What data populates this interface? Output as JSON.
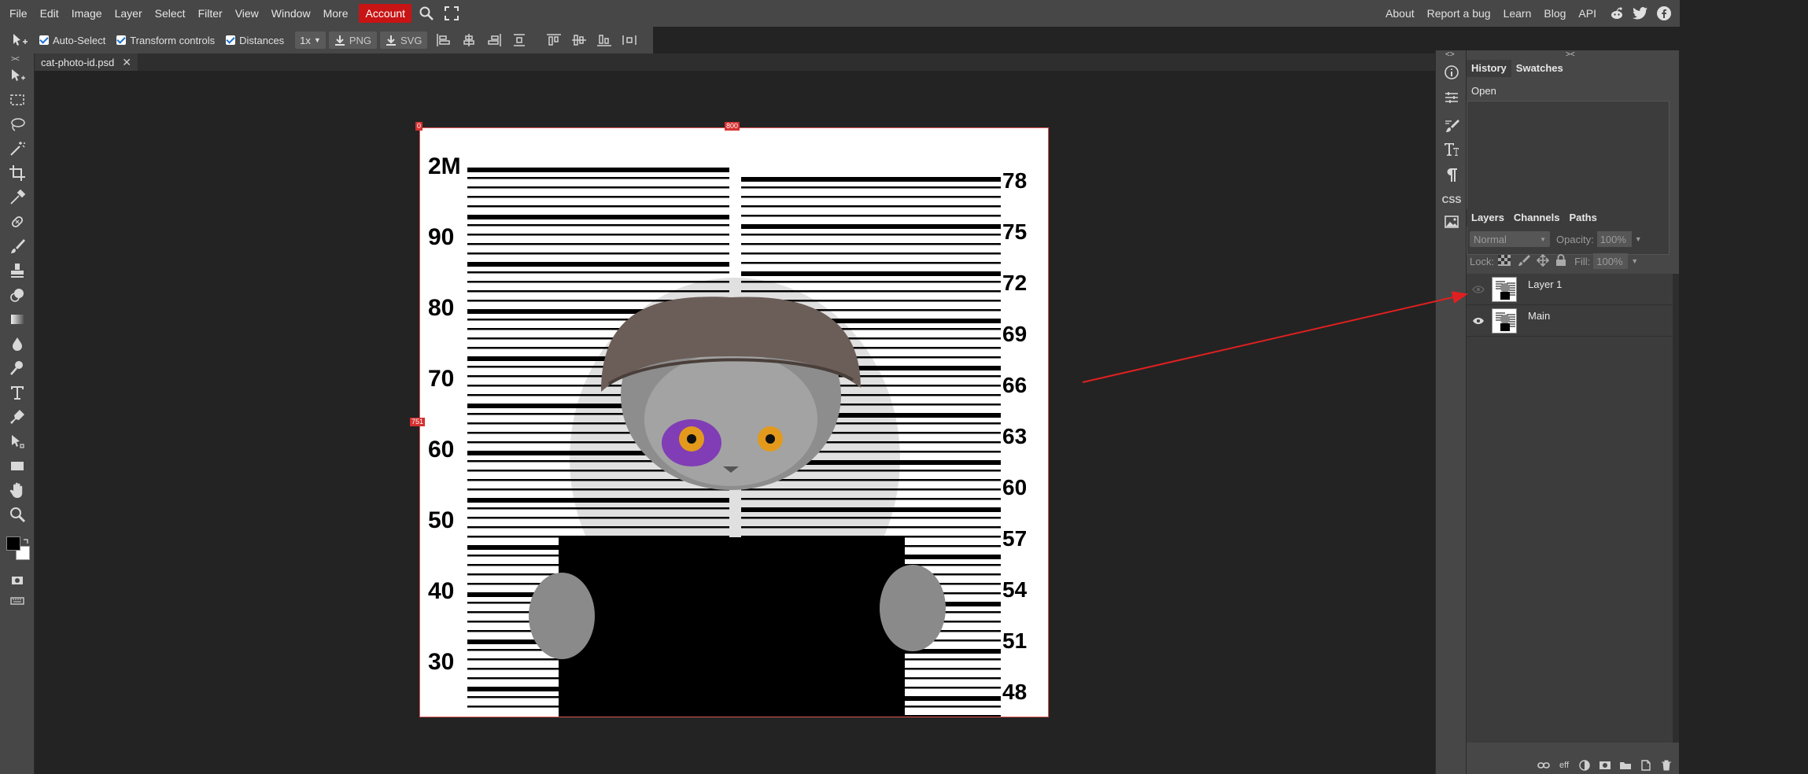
{
  "menu": {
    "items": [
      "File",
      "Edit",
      "Image",
      "Layer",
      "Select",
      "Filter",
      "View",
      "Window",
      "More"
    ],
    "account": "Account",
    "right_links": [
      "About",
      "Report a bug",
      "Learn",
      "Blog",
      "API"
    ]
  },
  "options": {
    "auto_select": "Auto-Select",
    "transform_controls": "Transform controls",
    "distances": "Distances",
    "zoom": "1x",
    "png": "PNG",
    "svg": "SVG"
  },
  "document": {
    "tab_name": "cat-photo-id.psd",
    "top_left_mark": "0",
    "top_mark": "800",
    "left_mark": "751",
    "left_scale": [
      "2M",
      "90",
      "80",
      "70",
      "60",
      "50",
      "40",
      "30"
    ],
    "right_scale": [
      "78",
      "75",
      "72",
      "69",
      "66",
      "63",
      "60",
      "57",
      "54",
      "51",
      "48"
    ]
  },
  "panels": {
    "history_tab": "History",
    "swatches_tab": "Swatches",
    "history_items": [
      "Open"
    ],
    "layers_tab": "Layers",
    "channels_tab": "Channels",
    "paths_tab": "Paths",
    "blend_mode": "Normal",
    "opacity_label": "Opacity:",
    "opacity_value": "100%",
    "lock_label": "Lock:",
    "fill_label": "Fill:",
    "fill_value": "100%",
    "layers": [
      {
        "name": "Layer 1",
        "visible": false
      },
      {
        "name": "Main",
        "visible": true
      }
    ],
    "bottom_eff": "eff"
  },
  "icons": {
    "strip": [
      "info-icon",
      "adjust-icon",
      "brush-settings-icon",
      "character-icon",
      "paragraph-icon",
      "css-icon",
      "image-icon"
    ],
    "css_label": "CSS"
  },
  "colors": {
    "accent": "#c81414",
    "arrow": "#e02020"
  }
}
